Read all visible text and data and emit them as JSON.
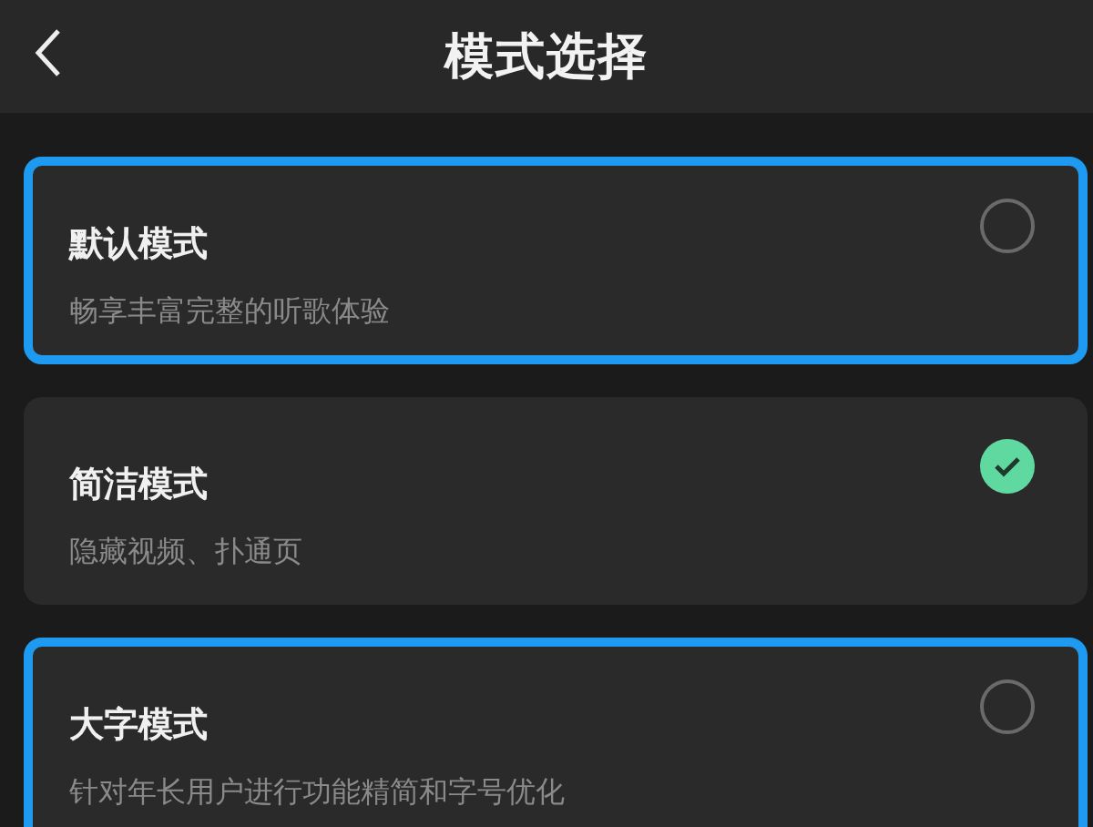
{
  "header": {
    "title": "模式选择"
  },
  "options": [
    {
      "title": "默认模式",
      "description": "畅享丰富完整的听歌体验",
      "selected": false,
      "highlighted": true
    },
    {
      "title": "简洁模式",
      "description": "隐藏视频、扑通页",
      "selected": true,
      "highlighted": false
    },
    {
      "title": "大字模式",
      "description": "针对年长用户进行功能精简和字号优化",
      "selected": false,
      "highlighted": true
    }
  ]
}
